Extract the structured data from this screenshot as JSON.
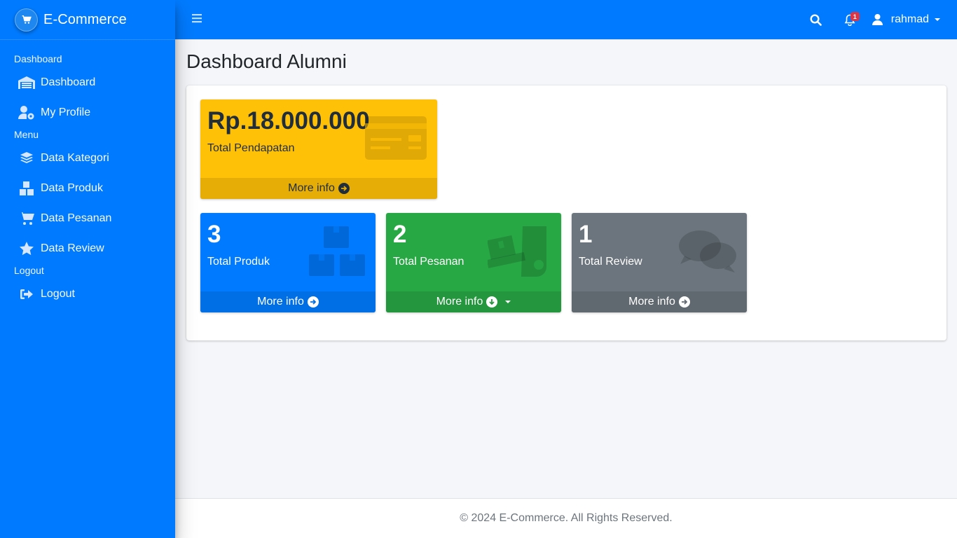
{
  "brand": {
    "name": "E-Commerce",
    "logo_icon": "cart-icon"
  },
  "sidebar": {
    "sections": [
      {
        "header": "Dashboard",
        "items": [
          {
            "label": "Dashboard",
            "icon": "warehouse-icon"
          },
          {
            "label": "My Profile",
            "icon": "user-cog-icon"
          }
        ]
      },
      {
        "header": "Menu",
        "items": [
          {
            "label": "Data Kategori",
            "icon": "layers-icon"
          },
          {
            "label": "Data Produk",
            "icon": "boxes-icon"
          },
          {
            "label": "Data Pesanan",
            "icon": "cart-icon"
          },
          {
            "label": "Data Review",
            "icon": "star-icon"
          }
        ]
      },
      {
        "header": "Logout",
        "items": [
          {
            "label": "Logout",
            "icon": "sign-out-icon"
          }
        ]
      }
    ]
  },
  "topbar": {
    "notification_count": "1",
    "username": "rahmad"
  },
  "page": {
    "title": "Dashboard Alumni"
  },
  "stats": {
    "revenue": {
      "value": "Rp.18.000.000",
      "label": "Total Pendapatan",
      "more": "More info",
      "color": "#ffc107"
    },
    "products": {
      "value": "3",
      "label": "Total Produk",
      "more": "More info",
      "color": "#007bff"
    },
    "orders": {
      "value": "2",
      "label": "Total Pesanan",
      "more": "More info",
      "color": "#28a745"
    },
    "reviews": {
      "value": "1",
      "label": "Total Review",
      "more": "More info",
      "color": "#6c757d"
    }
  },
  "footer": {
    "text": "© 2024 E-Commerce. All Rights Reserved."
  }
}
